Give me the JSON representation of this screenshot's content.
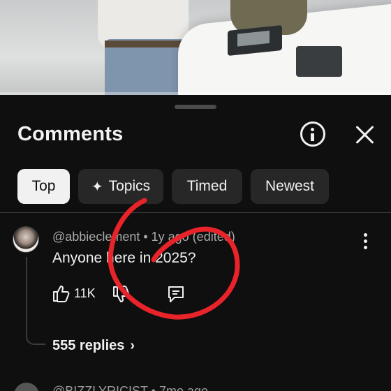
{
  "video": {
    "progress_fraction": 0.0
  },
  "panel": {
    "title": "Comments",
    "info_icon": "info-icon",
    "close_icon": "close-icon"
  },
  "chips": [
    {
      "label": "Top",
      "active": true
    },
    {
      "label": "Topics",
      "icon": "sparkle-icon",
      "active": false
    },
    {
      "label": "Timed",
      "active": false
    },
    {
      "label": "Newest",
      "active": false
    }
  ],
  "comment": {
    "author": "@abbieclement",
    "meta_suffix": " • 1y ago (edited)",
    "text": "Anyone here in 2025?",
    "like_count": "11K",
    "replies_label": "555 replies",
    "icons": [
      "like-icon",
      "dislike-icon",
      "reply-icon",
      "more-vert-icon"
    ]
  },
  "next_comment": {
    "author": "@BIZZLYRICIST",
    "meta_suffix": " • 7mo ago"
  },
  "colors": {
    "background": "#0f0f0f",
    "chip": "#272727",
    "chip_active": "#f1f1f1",
    "annotation": "#e8232a"
  }
}
